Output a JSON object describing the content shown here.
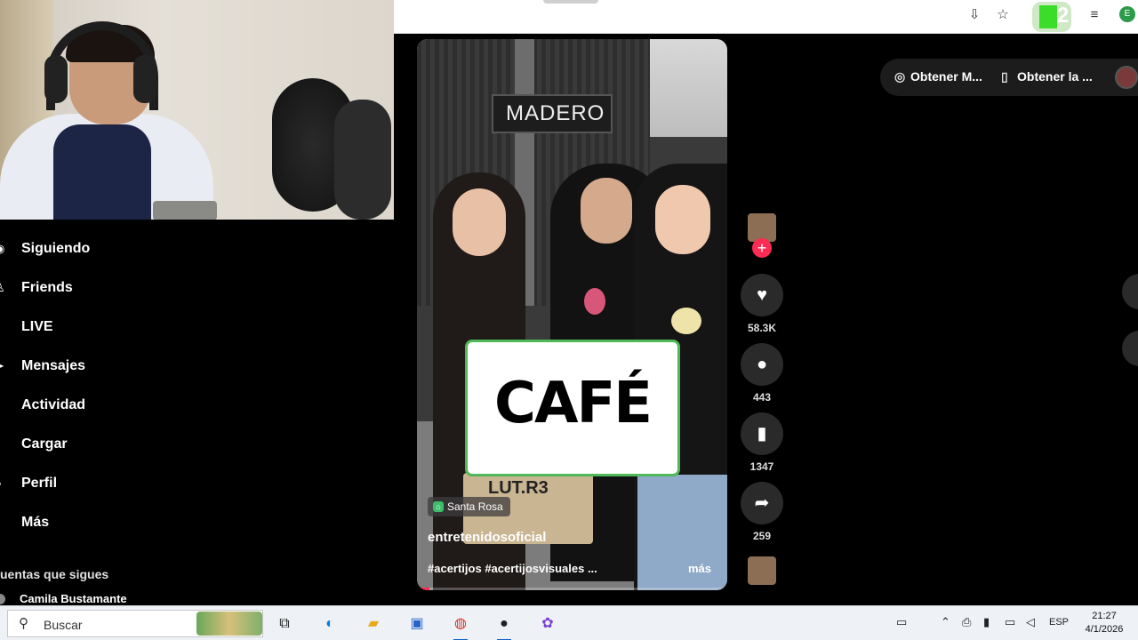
{
  "browser": {
    "extension_badge": "2",
    "profile_initial": "E"
  },
  "nav": {
    "items": [
      {
        "label": "Siguiendo",
        "icon": "following-icon"
      },
      {
        "label": "Friends",
        "icon": "friends-icon"
      },
      {
        "label": "LIVE",
        "icon": "live-icon"
      },
      {
        "label": "Mensajes",
        "icon": "messages-icon"
      },
      {
        "label": "Actividad",
        "icon": "activity-icon"
      },
      {
        "label": "Cargar",
        "icon": "upload-icon"
      },
      {
        "label": "Perfil",
        "icon": "profile-icon"
      },
      {
        "label": "Más",
        "icon": "more-icon"
      }
    ],
    "following_title": "uentas que sigues",
    "following_users": [
      "Camila Bustamante"
    ]
  },
  "video": {
    "sign_text": "MADERO",
    "bag_text": "LUT.R3",
    "overlay_word": "CAFÉ",
    "location": "Santa Rosa",
    "author": "entretenidosoficial",
    "hashtags": "#acertijos #acertijosvisuales ...",
    "more_label": "más"
  },
  "actions": {
    "likes": "58.3K",
    "comments": "443",
    "saves": "1347",
    "shares": "259"
  },
  "top_pills": {
    "pill1": "Obtener M...",
    "pill2": "Obtener la ..."
  },
  "taskbar": {
    "search_placeholder": "Buscar",
    "language": "ESP",
    "time": "21:27",
    "date": "4/1/2026"
  },
  "colors": {
    "accent": "#fe2c55",
    "taskbar_bg": "#eef1f6",
    "extension_green": "#3cdc2b"
  }
}
